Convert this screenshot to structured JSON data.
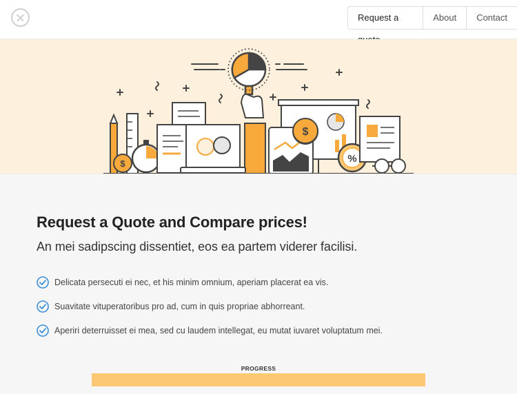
{
  "header": {
    "nav": [
      {
        "label": "Request a quote"
      },
      {
        "label": "About"
      },
      {
        "label": "Contact"
      }
    ]
  },
  "icons": {
    "close": "close-icon",
    "check": "check-circle-icon",
    "hero": "finance-analytics-illustration"
  },
  "colors": {
    "accent_orange": "#f7a93b",
    "hero_background": "#fdf0dc",
    "check_blue": "#3a8fd9",
    "progress_fill": "#fdc874"
  },
  "main": {
    "title": "Request a Quote and Compare prices!",
    "subtitle": "An mei sadipscing dissentiet, eos ea partem viderer facilisi.",
    "features": [
      {
        "text": "Delicata persecuti ei nec, et his minim omnium, aperiam placerat ea vis."
      },
      {
        "text": "Suavitate vituperatoribus pro ad, cum in quis propriae abhorreant."
      },
      {
        "text": "Aperiri deterruisset ei mea, sed cu laudem intellegat, eu mutat iuvaret voluptatum mei."
      }
    ]
  },
  "progress": {
    "label": "PROGRESS",
    "value": 1.0
  }
}
